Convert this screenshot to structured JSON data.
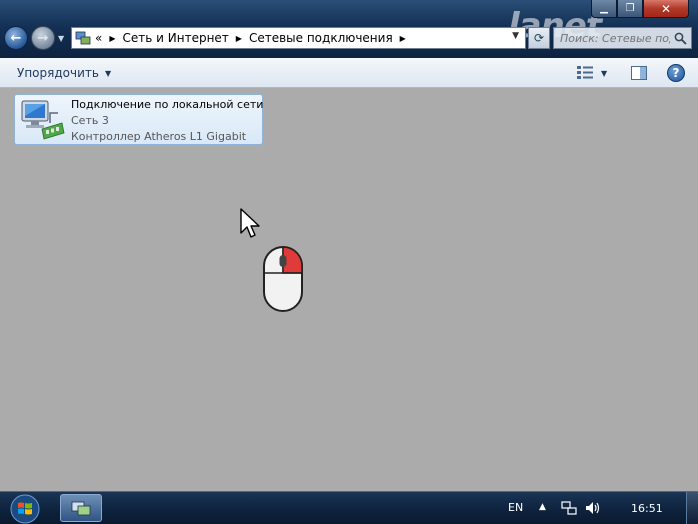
{
  "window": {
    "minimize_glyph": "▁",
    "maximize_glyph": "❐",
    "close_glyph": "✕"
  },
  "nav": {
    "back_glyph": "←",
    "forward_glyph": "→"
  },
  "address": {
    "prefix": "«",
    "parts": [
      "Сеть и Интернет",
      "Сетевые подключения"
    ]
  },
  "search": {
    "placeholder": "Поиск: Сетевые подключения"
  },
  "watermark": "lanet",
  "toolbar": {
    "organize_label": "Упорядочить",
    "help_glyph": "?"
  },
  "connection": {
    "name": "Подключение по локальной сети",
    "network": "Сеть  3",
    "device": "Контроллер Atheros L1 Gigabit"
  },
  "taskbar": {
    "language": "EN",
    "tray_arrow": "▲",
    "clock": "16:51"
  },
  "icons": {
    "back": "back-arrow-icon",
    "forward": "forward-arrow-icon",
    "network_folder": "network-connections-icon",
    "refresh": "refresh-icon",
    "search": "search-icon",
    "views": "change-view-icon",
    "preview_pane": "preview-pane-icon",
    "help": "help-icon",
    "adapter": "network-adapter-icon",
    "cursor": "mouse-pointer-icon",
    "mouse_hint": "right-click-mouse-icon",
    "start": "windows-start-icon",
    "network_tray": "network-tray-icon",
    "volume": "volume-icon"
  },
  "colors": {
    "titlebar": "#143055",
    "content_bg": "#ababab",
    "tile_border": "#8fb3d9",
    "mouse_right_button": "#e03a3a"
  }
}
